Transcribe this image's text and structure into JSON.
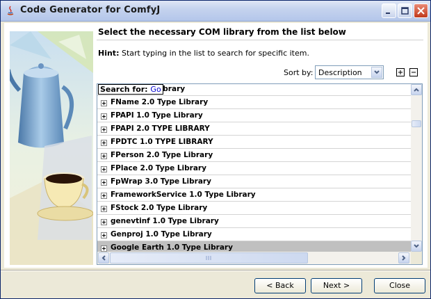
{
  "window": {
    "title": "Code Generator for ComfyJ"
  },
  "heading": "Select the necessary COM library from the list below",
  "hint": {
    "bold": "Hint:",
    "text": " Start typing in the list to search for specific item."
  },
  "sort": {
    "label": "Sort by:",
    "value": "Description"
  },
  "search": {
    "label": "Search for:",
    "go": "Go"
  },
  "partial_item": "Library",
  "items": [
    "FName 2.0 Type Library",
    "FPAPI 1.0 Type Library",
    "FPAPI 2.0 TYPE LIBRARY",
    "FPDTC 1.0 TYPE LIBRARY",
    "FPerson 2.0 Type Library",
    "FPlace 2.0 Type Library",
    "FpWrap 3.0 Type Library",
    "FrameworkService 1.0 Type Library",
    "FStock 2.0 Type Library",
    "genevtinf 1.0 Type Library",
    "Genproj 1.0 Type Library",
    "Google Earth 1.0 Type Library"
  ],
  "selected_item": "Google Earth 1.0 Type Library",
  "buttons": {
    "back": "< Back",
    "next": "Next >",
    "close": "Close"
  },
  "colors": {
    "selection": "#c0c0c0",
    "title_close": "#c0391c",
    "window_bg": "#ece9d8"
  }
}
